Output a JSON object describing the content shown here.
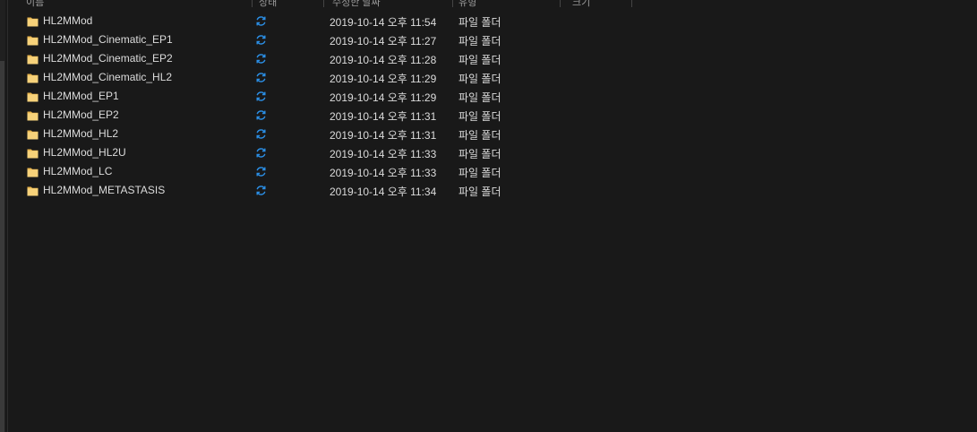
{
  "header": {
    "fragments": [
      "이름",
      "상태",
      "수정한 날짜",
      "유형",
      "크기"
    ]
  },
  "colors": {
    "background": "#191919",
    "text": "#dcdcdc",
    "folder": "#f5c96a",
    "sync": "#2b8fe6"
  },
  "files": [
    {
      "name": "HL2MMod",
      "status_icon": "sync-icon",
      "date": "2019-10-14 오후 11:54",
      "type": "파일 폴더"
    },
    {
      "name": "HL2MMod_Cinematic_EP1",
      "status_icon": "sync-icon",
      "date": "2019-10-14 오후 11:27",
      "type": "파일 폴더"
    },
    {
      "name": "HL2MMod_Cinematic_EP2",
      "status_icon": "sync-icon",
      "date": "2019-10-14 오후 11:28",
      "type": "파일 폴더"
    },
    {
      "name": "HL2MMod_Cinematic_HL2",
      "status_icon": "sync-icon",
      "date": "2019-10-14 오후 11:29",
      "type": "파일 폴더"
    },
    {
      "name": "HL2MMod_EP1",
      "status_icon": "sync-icon",
      "date": "2019-10-14 오후 11:29",
      "type": "파일 폴더"
    },
    {
      "name": "HL2MMod_EP2",
      "status_icon": "sync-icon",
      "date": "2019-10-14 오후 11:31",
      "type": "파일 폴더"
    },
    {
      "name": "HL2MMod_HL2",
      "status_icon": "sync-icon",
      "date": "2019-10-14 오후 11:31",
      "type": "파일 폴더"
    },
    {
      "name": "HL2MMod_HL2U",
      "status_icon": "sync-icon",
      "date": "2019-10-14 오후 11:33",
      "type": "파일 폴더"
    },
    {
      "name": "HL2MMod_LC",
      "status_icon": "sync-icon",
      "date": "2019-10-14 오후 11:33",
      "type": "파일 폴더"
    },
    {
      "name": "HL2MMod_METASTASIS",
      "status_icon": "sync-icon",
      "date": "2019-10-14 오후 11:34",
      "type": "파일 폴더"
    }
  ]
}
